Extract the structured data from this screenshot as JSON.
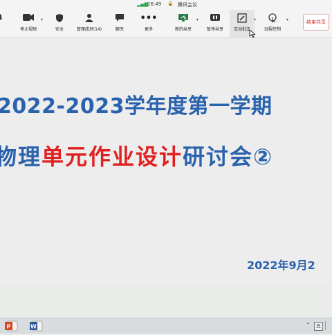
{
  "titlebar": {
    "time": "16:49",
    "app_title": "腾讯会议"
  },
  "toolbar": {
    "items": [
      {
        "label": "停止视频",
        "icon": "video-camera-icon"
      },
      {
        "label": "安全",
        "icon": "shield-icon"
      },
      {
        "label": "管理成员(14)",
        "icon": "members-icon"
      },
      {
        "label": "聊天",
        "icon": "chat-icon"
      },
      {
        "label": "更多",
        "icon": "more-icon"
      },
      {
        "label": "新的共享",
        "icon": "new-share-icon"
      },
      {
        "label": "暂停共享",
        "icon": "pause-share-icon"
      },
      {
        "label": "互动批注",
        "icon": "annotate-icon"
      },
      {
        "label": "远程控制",
        "icon": "remote-control-icon"
      }
    ],
    "end_share": "结束共享"
  },
  "slide": {
    "line1": "2022-2023学年度第一学期",
    "line2_a": "物理",
    "line2_b": "单元作业设计",
    "line2_c": "研讨会②",
    "date": "2022年9月2",
    "colors": {
      "blue": "#2a62ad",
      "red": "#e02020"
    }
  },
  "taskbar": {
    "apps": [
      "powerpoint-icon",
      "word-icon"
    ],
    "ime": "五"
  }
}
